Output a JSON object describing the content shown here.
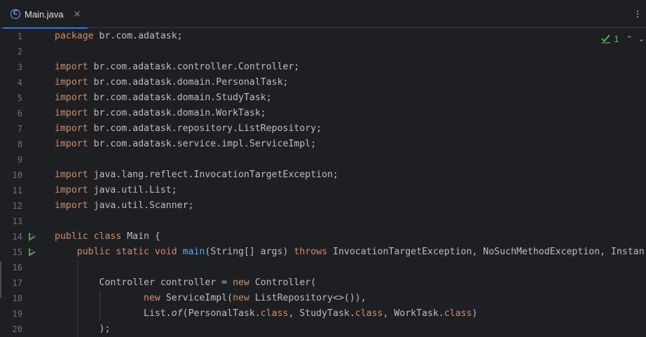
{
  "tab": {
    "icon": "class-icon",
    "icon_glyph": "C",
    "label": "Main.java",
    "close_glyph": "×"
  },
  "inspections": {
    "status_icon": "check-icon",
    "count": "1"
  },
  "colors": {
    "background": "#1e1f22",
    "keyword": "#cf8e6d",
    "function": "#56a8f5",
    "text": "#bcbec4",
    "line_number": "#6f737a",
    "accent": "#3574f0",
    "run": "#57965c"
  },
  "lines": [
    {
      "n": "1",
      "run": false,
      "tokens": [
        {
          "t": "package",
          "c": "kw"
        },
        {
          "t": " br.com.adatask;"
        }
      ]
    },
    {
      "n": "2",
      "run": false,
      "tokens": []
    },
    {
      "n": "3",
      "run": false,
      "tokens": [
        {
          "t": "import",
          "c": "kw"
        },
        {
          "t": " br.com.adatask.controller.Controller;"
        }
      ]
    },
    {
      "n": "4",
      "run": false,
      "tokens": [
        {
          "t": "import",
          "c": "kw"
        },
        {
          "t": " br.com.adatask.domain.PersonalTask;"
        }
      ]
    },
    {
      "n": "5",
      "run": false,
      "tokens": [
        {
          "t": "import",
          "c": "kw"
        },
        {
          "t": " br.com.adatask.domain.StudyTask;"
        }
      ]
    },
    {
      "n": "6",
      "run": false,
      "tokens": [
        {
          "t": "import",
          "c": "kw"
        },
        {
          "t": " br.com.adatask.domain.WorkTask;"
        }
      ]
    },
    {
      "n": "7",
      "run": false,
      "tokens": [
        {
          "t": "import",
          "c": "kw"
        },
        {
          "t": " br.com.adatask.repository.ListRepository;"
        }
      ]
    },
    {
      "n": "8",
      "run": false,
      "tokens": [
        {
          "t": "import",
          "c": "kw"
        },
        {
          "t": " br.com.adatask.service.impl.ServiceImpl;"
        }
      ]
    },
    {
      "n": "9",
      "run": false,
      "tokens": []
    },
    {
      "n": "10",
      "run": false,
      "tokens": [
        {
          "t": "import",
          "c": "kw"
        },
        {
          "t": " java.lang.reflect.InvocationTargetException;"
        }
      ]
    },
    {
      "n": "11",
      "run": false,
      "tokens": [
        {
          "t": "import",
          "c": "kw"
        },
        {
          "t": " java.util.List;"
        }
      ]
    },
    {
      "n": "12",
      "run": false,
      "tokens": [
        {
          "t": "import",
          "c": "kw"
        },
        {
          "t": " java.util.Scanner;"
        }
      ]
    },
    {
      "n": "13",
      "run": false,
      "tokens": []
    },
    {
      "n": "14",
      "run": true,
      "tokens": [
        {
          "t": "public class",
          "c": "kw"
        },
        {
          "t": " Main {"
        }
      ]
    },
    {
      "n": "15",
      "run": true,
      "tokens": [
        {
          "t": "    "
        },
        {
          "t": "public static void",
          "c": "kw"
        },
        {
          "t": " "
        },
        {
          "t": "main",
          "c": "fn"
        },
        {
          "t": "(String[] args) "
        },
        {
          "t": "throws",
          "c": "kw"
        },
        {
          "t": " InvocationTargetException, NoSuchMethodException, Instan"
        }
      ]
    },
    {
      "n": "16",
      "run": false,
      "tokens": []
    },
    {
      "n": "17",
      "run": false,
      "tokens": [
        {
          "t": "        Controller controller = "
        },
        {
          "t": "new",
          "c": "kw"
        },
        {
          "t": " Controller("
        }
      ]
    },
    {
      "n": "18",
      "run": false,
      "tokens": [
        {
          "t": "                "
        },
        {
          "t": "new",
          "c": "kw"
        },
        {
          "t": " ServiceImpl("
        },
        {
          "t": "new",
          "c": "kw"
        },
        {
          "t": " ListRepository<>()),"
        }
      ]
    },
    {
      "n": "19",
      "run": false,
      "tokens": [
        {
          "t": "                List."
        },
        {
          "t": "of",
          "c": "it"
        },
        {
          "t": "(PersonalTask."
        },
        {
          "t": "class",
          "c": "kw"
        },
        {
          "t": ", StudyTask."
        },
        {
          "t": "class",
          "c": "kw"
        },
        {
          "t": ", WorkTask."
        },
        {
          "t": "class",
          "c": "kw"
        },
        {
          "t": ")"
        }
      ]
    },
    {
      "n": "20",
      "run": false,
      "tokens": [
        {
          "t": "        );"
        }
      ]
    }
  ]
}
